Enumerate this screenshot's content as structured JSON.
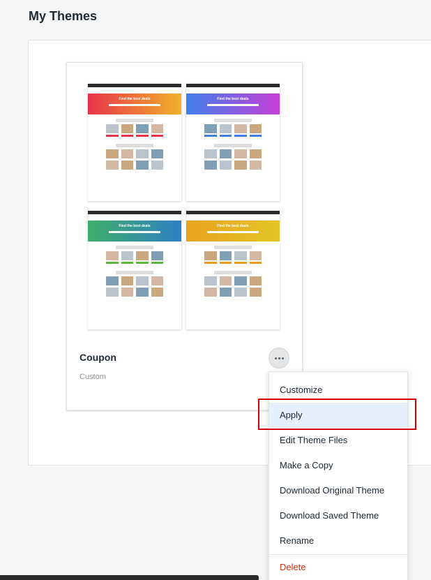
{
  "page": {
    "title": "My Themes"
  },
  "theme": {
    "name": "Coupon",
    "subtitle": "Custom",
    "preview_hero_text": "Find the best deals",
    "preview_colors": {
      "red": "#e8344a",
      "blue": "#3f7ee8",
      "green": "#3fae6a",
      "orange": "#e8a21f"
    }
  },
  "more_button": {
    "icon": "more-horizontal-icon"
  },
  "menu": {
    "items": [
      {
        "label": "Customize"
      },
      {
        "label": "Apply"
      },
      {
        "label": "Edit Theme Files"
      },
      {
        "label": "Make a Copy"
      },
      {
        "label": "Download Original Theme"
      },
      {
        "label": "Download Saved Theme"
      },
      {
        "label": "Rename"
      }
    ],
    "delete_label": "Delete"
  }
}
